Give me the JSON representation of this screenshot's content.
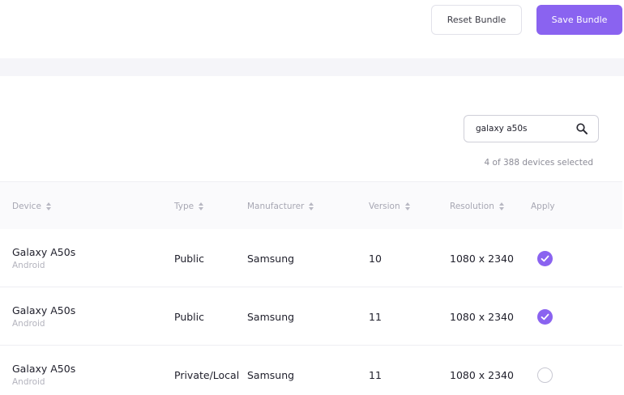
{
  "toolbar": {
    "reset_label": "Reset Bundle",
    "save_label": "Save Bundle"
  },
  "search": {
    "value": "galaxy a50s",
    "icon": "search-icon"
  },
  "selection": {
    "count_text": "4 of 388 devices selected"
  },
  "table": {
    "columns": [
      "Device",
      "Type",
      "Manufacturer",
      "Version",
      "Resolution",
      "Apply"
    ],
    "rows": [
      {
        "device": "Galaxy A50s",
        "os": "Android",
        "type": "Public",
        "manufacturer": "Samsung",
        "version": "10",
        "resolution": "1080 x 2340",
        "applied": true
      },
      {
        "device": "Galaxy A50s",
        "os": "Android",
        "type": "Public",
        "manufacturer": "Samsung",
        "version": "11",
        "resolution": "1080 x 2340",
        "applied": true
      },
      {
        "device": "Galaxy A50s",
        "os": "Android",
        "type": "Private/Local",
        "manufacturer": "Samsung",
        "version": "11",
        "resolution": "1080 x 2340",
        "applied": false
      }
    ]
  },
  "colors": {
    "accent": "#8a63f0",
    "page_bg": "#f5f5f9",
    "muted_text": "#a7a7b3"
  }
}
